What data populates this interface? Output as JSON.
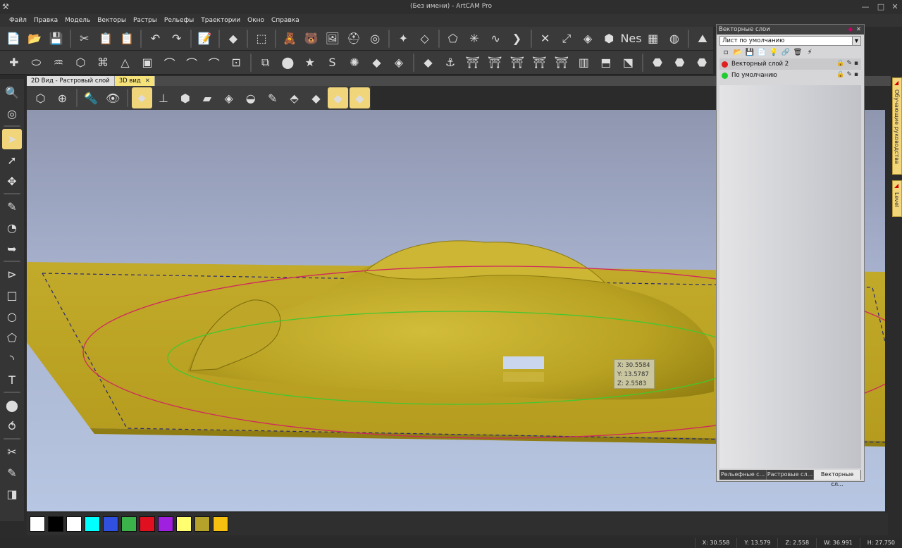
{
  "window": {
    "title": "(Без имени) - ArtCAM Pro",
    "min": "—",
    "max": "□",
    "close": "✕"
  },
  "menu": [
    "Файл",
    "Правка",
    "Модель",
    "Векторы",
    "Растры",
    "Рельефы",
    "Траектории",
    "Окно",
    "Справка"
  ],
  "toolbar1": [
    "📄",
    "📂",
    "💾",
    "|",
    "✂",
    "📋",
    "📋",
    "|",
    "↶",
    "↷",
    "|",
    "📝",
    "|",
    "◆",
    "|",
    "⬚",
    "|",
    "🧸",
    "🐻",
    "🖼",
    "⛑",
    "◎",
    "|",
    "✦",
    "◇",
    "|",
    "⬠",
    "✳",
    "∿",
    "❯",
    "|",
    "✕",
    "⤢",
    "◈",
    "⬢",
    "Nes",
    "▦",
    "◍",
    "|",
    "⛰"
  ],
  "toolbar2": [
    "✚",
    "⬭",
    "♒",
    "⬡",
    "⌘",
    "△",
    "▣",
    "⌒",
    "⌒",
    "⌒",
    "⊡",
    "|",
    "⧉",
    "⬤",
    "★",
    "S",
    "✺",
    "◆",
    "◈",
    "|",
    "◆",
    "⚓",
    "⛩",
    "⛩",
    "⛩",
    "⛩",
    "⛩",
    "▥",
    "⬒",
    "⬔",
    "|",
    "⬣",
    "⬣",
    "⬣"
  ],
  "doc_tabs": [
    {
      "label": "2D Вид - Растровый слой",
      "active": false
    },
    {
      "label": "3D вид",
      "active": true,
      "close": "✕"
    }
  ],
  "view_toolbar": [
    "⬡",
    "⊕",
    "|",
    "🔦",
    "👁",
    "|",
    "⬥",
    "⊥",
    "⬢",
    "▰",
    "◈",
    "◒",
    "✎",
    "⬘",
    "◆",
    "◆",
    "◆"
  ],
  "left_tools": [
    "🔍",
    "◎",
    "|",
    "➤",
    "➚",
    "✥",
    "|",
    "✎",
    "◔",
    "➥",
    "|",
    "⊳",
    "□",
    "○",
    "⬠",
    "◝",
    "T",
    "|",
    "⬤",
    "⥀",
    "|",
    "✂",
    "✎",
    "◨"
  ],
  "palette": [
    "#ffffff",
    "#000000",
    "#ffffff",
    "#00ffff",
    "#3050e0",
    "#3cb34a",
    "#e01020",
    "#a020e0",
    "#ffff70",
    "#b5a22a",
    "#f5c010"
  ],
  "status": {
    "x": "X: 30.558",
    "y": "Y: 13.579",
    "z": "Z: 2.558",
    "w": "W: 36.991",
    "h": "H: 27.750"
  },
  "coords_popup": {
    "x": "X: 30.5584",
    "y": "Y: 13.5787",
    "z": "Z: 2.5583"
  },
  "panel": {
    "title": "Векторные слои",
    "pin_icon": "pin",
    "close": "✕",
    "sheet_select": "Лист по умолчанию",
    "tools": [
      "▫",
      "📂",
      "💾",
      "📄",
      "💡",
      "🔗",
      "🗑",
      "⚡"
    ],
    "layers": [
      {
        "name": "Векторный слой 2",
        "color": "#e02020",
        "icons": "🔒 ✎ ▪"
      },
      {
        "name": "По умолчанию",
        "color": "#20cc30",
        "icons": "🔒 ✎ ▪"
      }
    ],
    "tabs": [
      {
        "label": "Рельефные с...",
        "active": false
      },
      {
        "label": "Растровые сл...",
        "active": false
      },
      {
        "label": "Векторные сл...",
        "active": true
      }
    ]
  },
  "dock_tabs": [
    "Обучающие руководства",
    "Level"
  ]
}
